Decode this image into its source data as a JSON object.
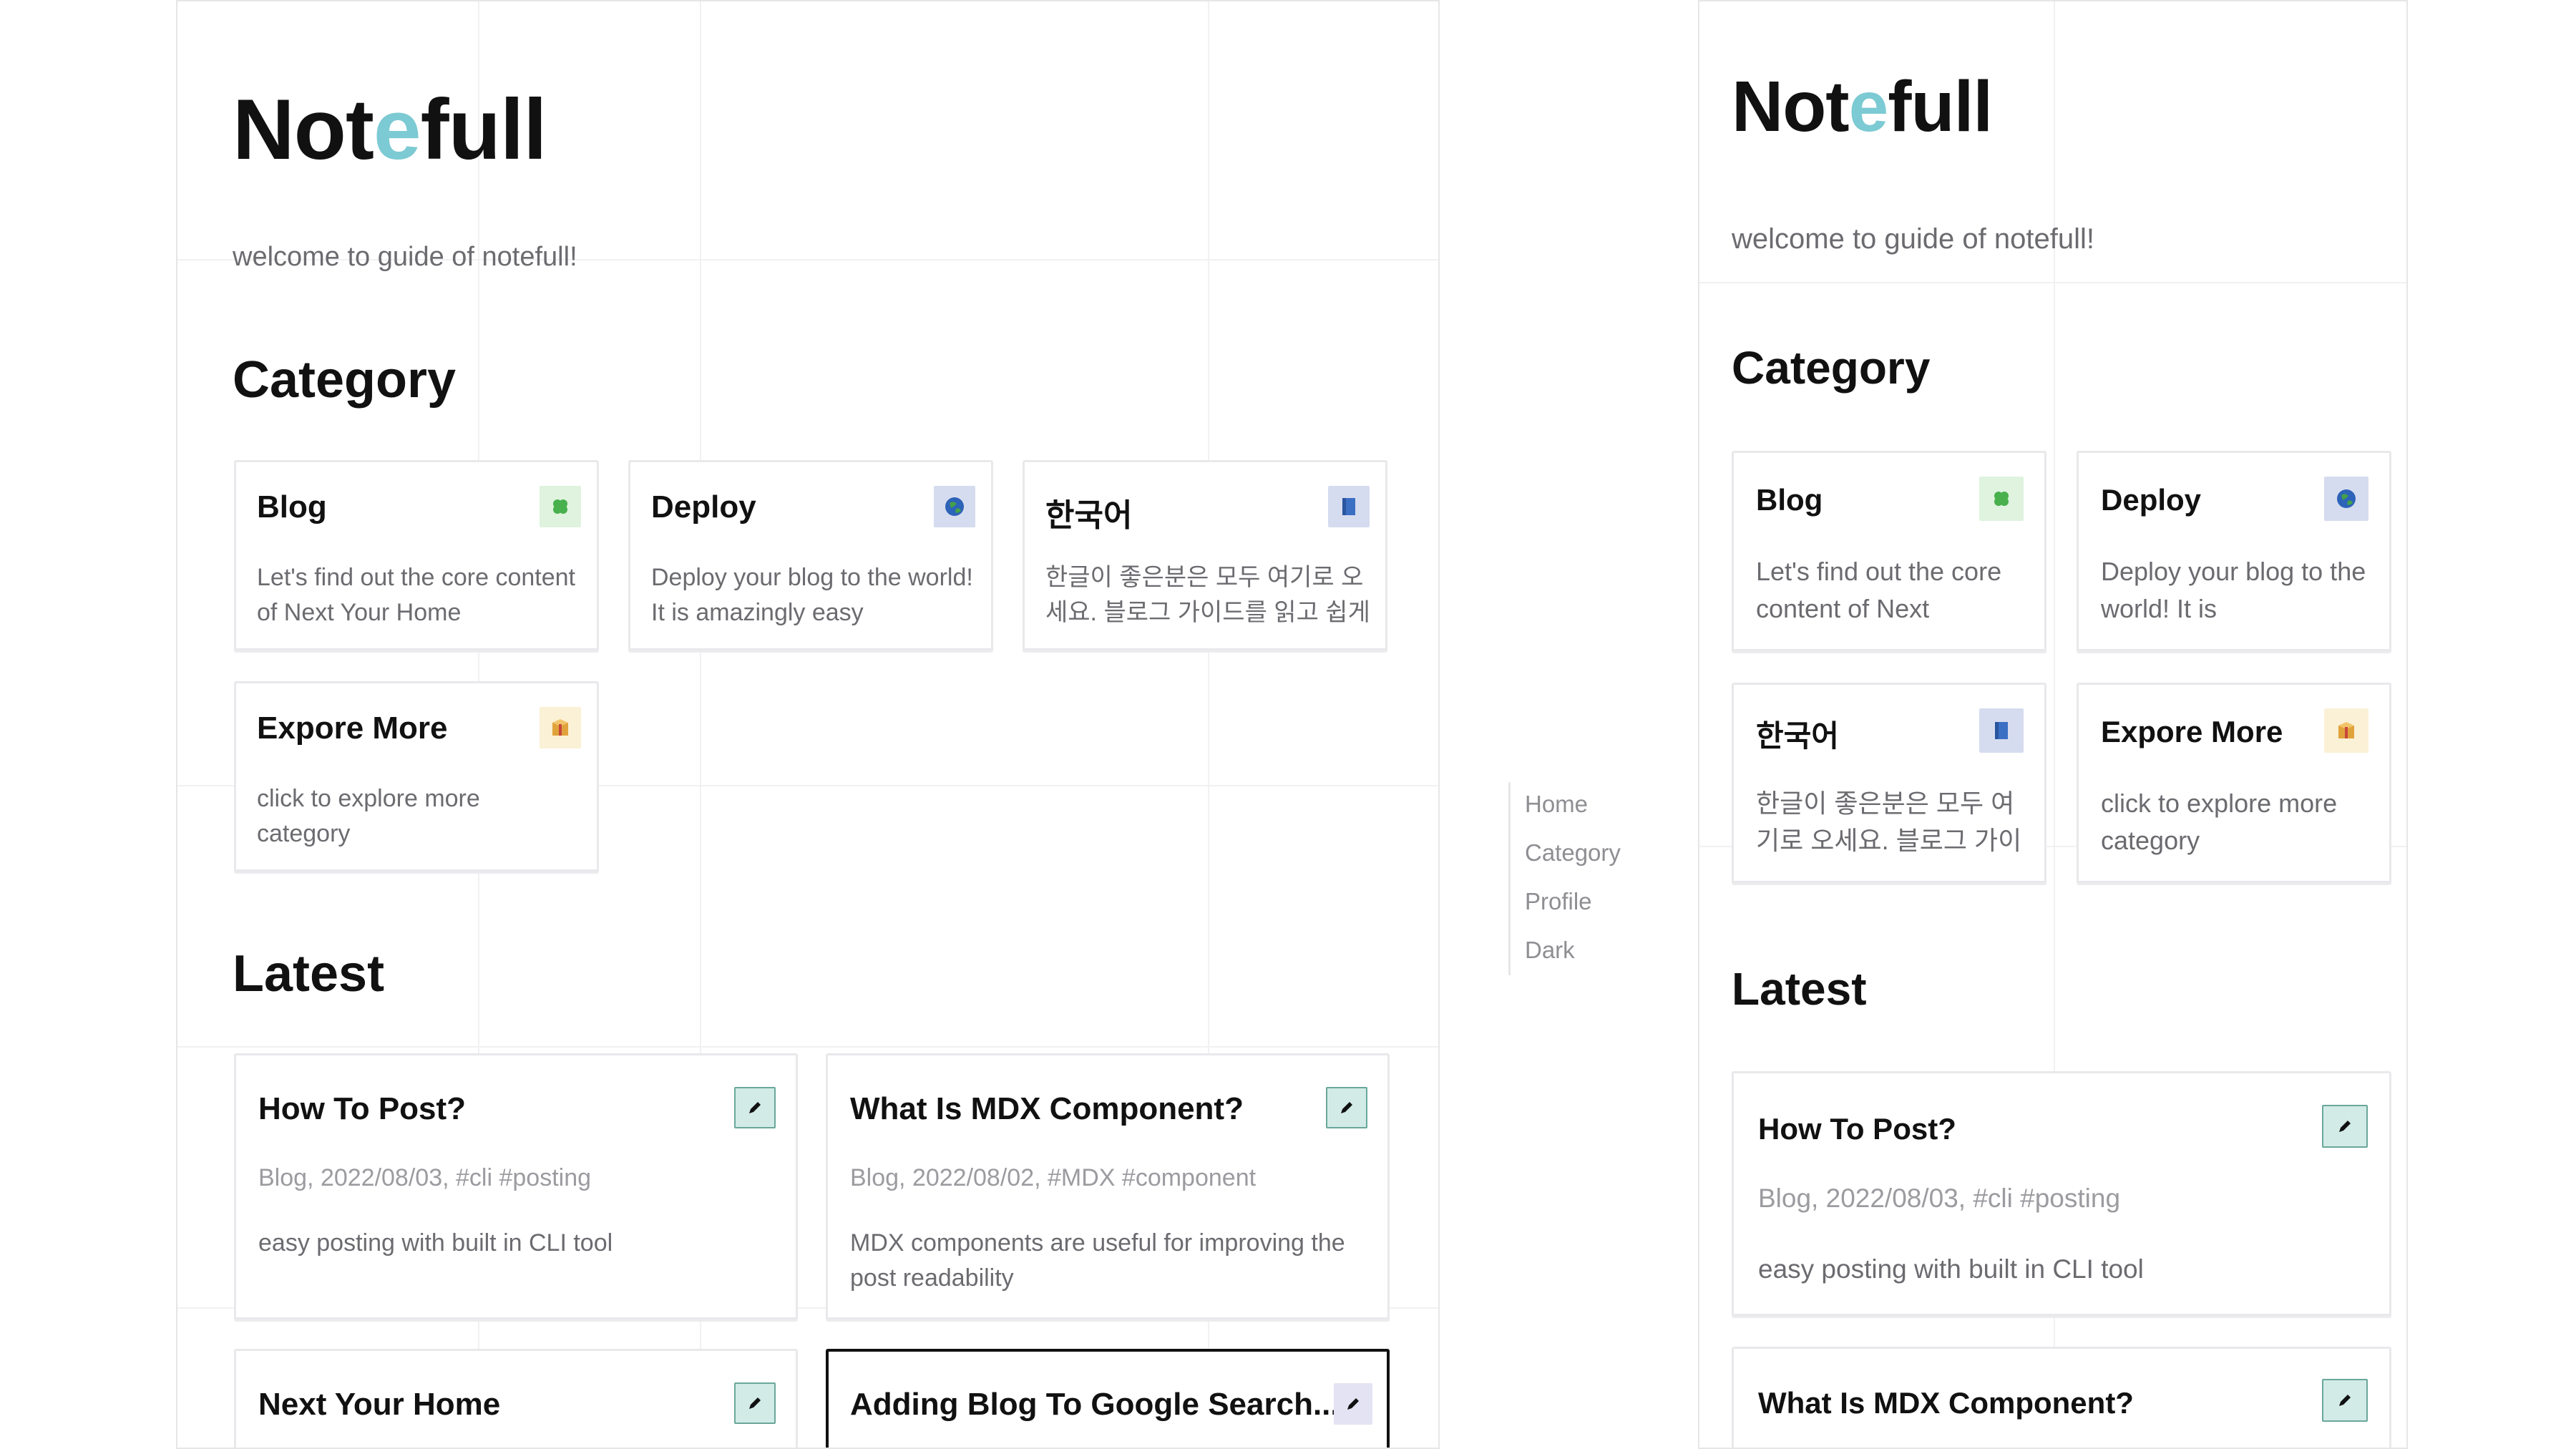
{
  "brand": {
    "name_before": "Not",
    "name_accent": "e",
    "name_after": "full",
    "accent_color": "#7ccad3"
  },
  "subtitle": "welcome to guide of notefull!",
  "sections": {
    "category": "Category",
    "latest": "Latest"
  },
  "categories": [
    {
      "title": "Blog",
      "icon": "clover-icon",
      "desc_desktop": "Let's find out the core content of Next Your Home",
      "desc_mobile": "Let's find out the core content of Next"
    },
    {
      "title": "Deploy",
      "icon": "globe-icon",
      "desc_desktop": "Deploy your blog to the world! It is amazingly easy",
      "desc_mobile": "Deploy your blog to the world! It is"
    },
    {
      "title": "한국어",
      "icon": "book-icon",
      "desc_desktop": "한글이 좋은분은 모두 여기로 오세요. 블로그 가이드를 읽고 쉽게",
      "desc_mobile": "한글이 좋은분은 모두 여기로 오세요. 블로그 가이"
    },
    {
      "title": "Expore More",
      "icon": "package-icon",
      "desc_desktop": "click to explore more category",
      "desc_mobile": "click to explore more category"
    }
  ],
  "posts": [
    {
      "title": "How To Post?",
      "meta": "Blog, 2022/08/03, #cli #posting",
      "desc": "easy posting with built in CLI tool",
      "icon": "pencil-icon"
    },
    {
      "title": "What Is MDX Component?",
      "meta": "Blog, 2022/08/02, #MDX #component",
      "desc": "MDX components are useful for improving the post readability",
      "icon": "pencil-icon"
    },
    {
      "title": "Next Your Home",
      "icon": "pencil-icon"
    },
    {
      "title": "Adding Blog To Google Search...",
      "icon": "pencil-icon"
    }
  ],
  "nav": {
    "items": [
      "Home",
      "Category",
      "Profile",
      "Dark"
    ]
  }
}
